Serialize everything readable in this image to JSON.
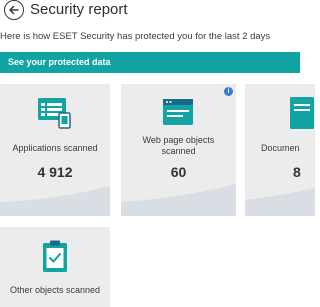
{
  "header": {
    "title": "Security report",
    "subtitle": "Here is how ESET Security has protected you for the last 2 days"
  },
  "banner": {
    "label": "See your protected data"
  },
  "cards": [
    {
      "label": "Applications scanned",
      "value": "4 912"
    },
    {
      "label": "Web page objects scanned",
      "value": "60"
    },
    {
      "label": "Documen",
      "value": "8"
    },
    {
      "label": "Other objects scanned",
      "value": ""
    }
  ],
  "colors": {
    "accent": "#12a3a3",
    "card_bg": "#ececec",
    "wave": "#d9dde4",
    "info": "#2f7fd8"
  }
}
